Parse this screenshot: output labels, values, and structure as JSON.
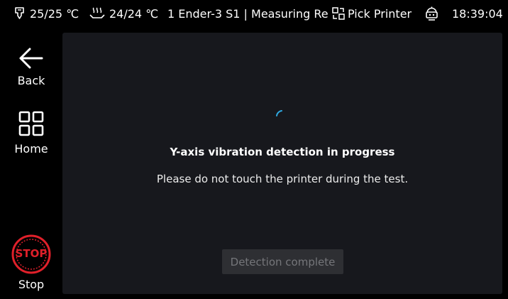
{
  "status_bar": {
    "nozzle_temp": "25/25 ℃",
    "bed_temp": "24/24 ℃",
    "printer_name": "1 Ender-3 S1 | Measuring Re",
    "pick_printer_label": "Pick Printer",
    "time": "18:39:04"
  },
  "sidebar": {
    "back_label": "Back",
    "home_label": "Home",
    "stop_icon_text": "STOP",
    "stop_label": "Stop"
  },
  "main": {
    "title": "Y-axis vibration detection in progress",
    "subtitle": "Please do not touch the printer during the test.",
    "complete_button_label": "Detection complete"
  },
  "colors": {
    "accent_spinner": "#2fa8e0",
    "stop_red": "#e0202a",
    "panel_bg": "#17181d"
  }
}
